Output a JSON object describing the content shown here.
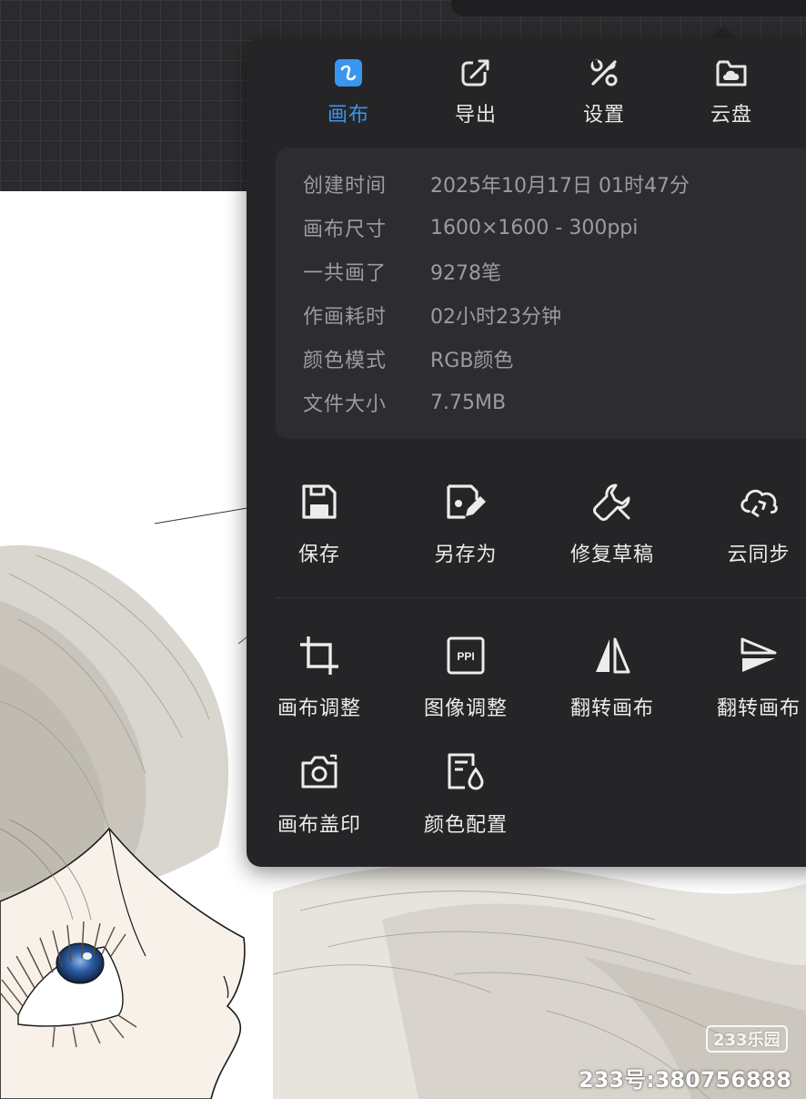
{
  "colors": {
    "accent": "#3a95f0",
    "panel": "#252527",
    "card": "#2d2d30",
    "muted_text": "#9c9ca0"
  },
  "tabs": [
    {
      "label": "画布",
      "icon": "canvas-icon",
      "active": true
    },
    {
      "label": "导出",
      "icon": "export-icon",
      "active": false
    },
    {
      "label": "设置",
      "icon": "settings-tools-icon",
      "active": false
    },
    {
      "label": "云盘",
      "icon": "cloud-drive-icon",
      "active": false
    }
  ],
  "info": [
    {
      "key": "创建时间",
      "value": "2025年10月17日 01时47分"
    },
    {
      "key": "画布尺寸",
      "value": "1600×1600 - 300ppi"
    },
    {
      "key": "一共画了",
      "value": "9278笔"
    },
    {
      "key": "作画耗时",
      "value": "02小时23分钟"
    },
    {
      "key": "颜色模式",
      "value": "RGB颜色"
    },
    {
      "key": "文件大小",
      "value": "7.75MB"
    }
  ],
  "actions_file": [
    {
      "label": "保存",
      "icon": "save-icon"
    },
    {
      "label": "另存为",
      "icon": "save-as-icon"
    },
    {
      "label": "修复草稿",
      "icon": "wrench-icon"
    },
    {
      "label": "云同步",
      "icon": "cloud-sync-icon"
    }
  ],
  "actions_canvas": [
    {
      "label": "画布调整",
      "icon": "crop-icon"
    },
    {
      "label": "图像调整",
      "icon": "ppi-icon"
    },
    {
      "label": "翻转画布",
      "icon": "flip-horizontal-icon"
    },
    {
      "label": "翻转画布",
      "icon": "flip-vertical-icon"
    },
    {
      "label": "画布盖印",
      "icon": "camera-icon"
    },
    {
      "label": "颜色配置",
      "icon": "color-profile-icon"
    }
  ],
  "watermark": {
    "logo": "233乐园",
    "id": "233号:380756888"
  }
}
